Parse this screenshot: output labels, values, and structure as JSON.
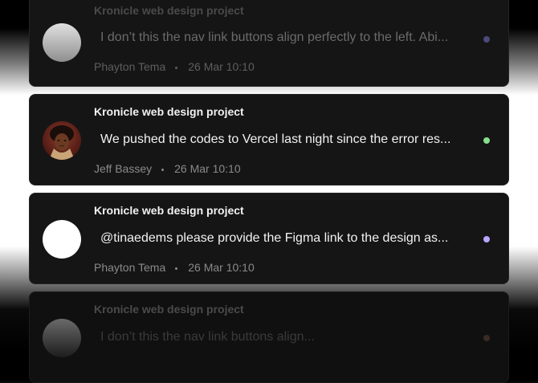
{
  "notifications": [
    {
      "project": "Kronicle web design project",
      "message": "I don’t this the nav link buttons align perfectly to the left. Abi...",
      "author": "Phayton Tema",
      "time": "26 Mar 10:10",
      "status_color": "#4b4a7a"
    },
    {
      "project": "Kronicle web design project",
      "message": "We pushed the codes to Vercel last night since the error res...",
      "author": "Jeff Bassey",
      "time": "26 Mar 10:10",
      "status_color": "#86e08a"
    },
    {
      "project": "Kronicle web design project",
      "message": "@tinaedems please provide the Figma link to the design as...",
      "author": "Phayton Tema",
      "time": "26 Mar 10:10",
      "status_color": "#b9a6ff"
    },
    {
      "project": "Kronicle web design project",
      "message": "I don’t this the nav link buttons align...",
      "status_color": "#3a2a24"
    }
  ]
}
